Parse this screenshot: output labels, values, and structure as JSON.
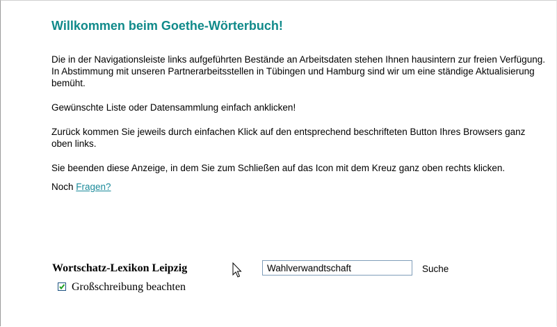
{
  "page": {
    "title": "Willkommen beim Goethe-Wörterbuch!",
    "intro": "Die in der Navigationsleiste links aufgeführten Bestände an Arbeitsdaten stehen Ihnen hausintern zur freien Verfügung. In Abstimmung mit unseren Partnerarbeitsstellen in Tübingen und Hamburg sind wir um eine ständige Aktualisierung bemüht.",
    "instruction_click": "Gewünschte Liste oder Datensammlung einfach anklicken!",
    "instruction_back": "Zurück kommen Sie jeweils durch einfachen Klick auf den entsprechend beschrifteten Button Ihres Browsers ganz oben links.",
    "instruction_close": "Sie beenden diese Anzeige, in dem Sie zum Schließen auf das Icon mit dem Kreuz ganz oben rechts klicken.",
    "questions_prefix": "Noch",
    "questions_link": "Fragen?"
  },
  "search": {
    "lexicon_label": "Wortschatz-Lexikon Leipzig",
    "input_value": "Wahlverwandtschaft",
    "button_label": "Suche",
    "checkbox_label": "Großschreibung beachten",
    "checkbox_checked": true
  },
  "icons": {
    "checkmark": "checkmark-icon",
    "cursor": "mouse-pointer-icon"
  },
  "colors": {
    "title": "#108a8a",
    "link": "#1a8a9a",
    "checkbox_border": "#1c5180",
    "checkmark": "#21a121"
  }
}
